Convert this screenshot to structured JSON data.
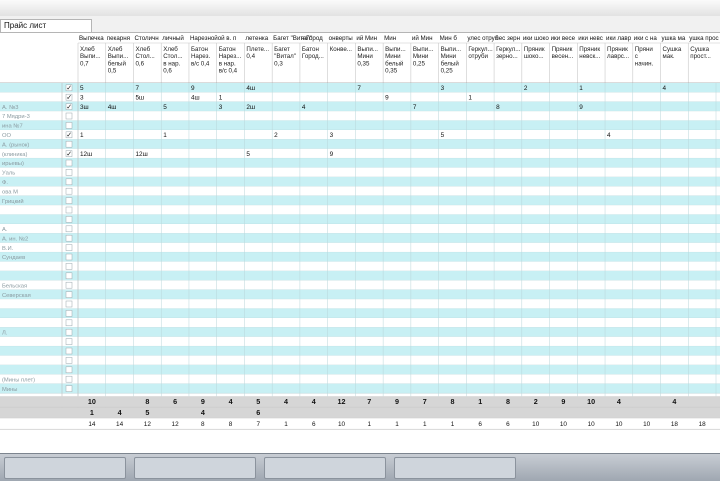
{
  "tab": {
    "label": "Прайс лист"
  },
  "colors": {
    "row_blue": "#c8f0f4",
    "row_white": "#ffffff",
    "grid": "#b9d6da",
    "total_gray": "#d6d6d6"
  },
  "columns": [
    {
      "group": "Выпечка",
      "name": "Хлеб\nВыпи...\n0,7"
    },
    {
      "group": "пекарня",
      "name": "Хлеб\nВыпи...\nбелый\n0,5"
    },
    {
      "group": "Столичн",
      "name": "Хлеб\nСтол...\n0,6"
    },
    {
      "group": "личный",
      "name": "Хлеб\nСтол...\nв нар.\n0,6"
    },
    {
      "group": "Нарезной",
      "name": "Батон\nНарез.\nв/с 0,4"
    },
    {
      "group": "ой в. п",
      "name": "Батон\nНарез...\nв нар.\nв/с 0,4"
    },
    {
      "group": "летенка",
      "name": "Плете...\n0,4"
    },
    {
      "group": "Багет \"Витал\"",
      "name": "Багет\n\"Витал\"\n0,3"
    },
    {
      "group": "н Город",
      "name": "Батон\nГород..."
    },
    {
      "group": "онверты",
      "name": "Конве..."
    },
    {
      "group": "ий Мин",
      "name": "Выпи...\nМини\n0,35"
    },
    {
      "group": "Мин",
      "name": "Выпи...\nМини\nбелый\n0,35"
    },
    {
      "group": "ий Мин",
      "name": "Выпи...\nМини\n0,25"
    },
    {
      "group": "Мин б",
      "name": "Выпи...\nМини\nбелый\n0,25"
    },
    {
      "group": "улес отруб",
      "name": "Геркул...\nотруби"
    },
    {
      "group": "лес зерн",
      "name": "Геркул...\nзерно..."
    },
    {
      "group": "ики шоко",
      "name": "Пряник\nшоко..."
    },
    {
      "group": "ики весе",
      "name": "Пряник\nвесен..."
    },
    {
      "group": "ики невс",
      "name": "Пряник\nневск..."
    },
    {
      "group": "ики лавр",
      "name": "Пряник\nлаврс..."
    },
    {
      "group": "ики с на",
      "name": "Пряни\nс\nначин."
    },
    {
      "group": "ушка ма",
      "name": "Сушка\nмак."
    },
    {
      "group": "ушка прос",
      "name": "Сушка\nпрост..."
    }
  ],
  "rows": [
    {
      "label": "",
      "check": "✓",
      "cells": [
        "5",
        "",
        "7",
        "",
        "9",
        "",
        "4ш",
        "",
        "",
        "",
        "7",
        "",
        "",
        "3",
        "",
        "",
        "2",
        "",
        "1",
        "",
        "",
        "4",
        ""
      ]
    },
    {
      "label": "",
      "check": "✓",
      "cells": [
        "3",
        "",
        "5ш",
        "",
        "4ш",
        "1",
        "",
        "",
        "",
        "",
        "",
        "9",
        "",
        "",
        "1",
        "",
        "",
        "",
        "",
        "",
        "",
        "",
        ""
      ]
    },
    {
      "label": "А. №3",
      "check": "✓",
      "cells": [
        "3ш",
        "4ш",
        "",
        "5",
        "",
        "3",
        "2ш",
        "",
        "4",
        "",
        "",
        "",
        "7",
        "",
        "",
        "8",
        "",
        "",
        "9",
        "",
        "",
        "",
        ""
      ]
    },
    {
      "label": "7 Мядри-3",
      "check": "",
      "cells": [
        "",
        "",
        "",
        "",
        "",
        "",
        "",
        "",
        "",
        "",
        "",
        "",
        "",
        "",
        "",
        "",
        "",
        "",
        "",
        "",
        "",
        "",
        ""
      ]
    },
    {
      "label": "ина №7",
      "check": "",
      "cells": [
        "",
        "",
        "",
        "",
        "",
        "",
        "",
        "",
        "",
        "",
        "",
        "",
        "",
        "",
        "",
        "",
        "",
        "",
        "",
        "",
        "",
        "",
        ""
      ]
    },
    {
      "label": "ОО",
      "check": "✓",
      "cells": [
        "1",
        "",
        "",
        "1",
        "",
        "",
        "",
        "2",
        "",
        "3",
        "",
        "",
        "",
        "5",
        "",
        "",
        "",
        "",
        "",
        "4",
        "",
        "",
        ""
      ]
    },
    {
      "label": "А. (рынок)",
      "check": "",
      "cells": [
        "",
        "",
        "",
        "",
        "",
        "",
        "",
        "",
        "",
        "",
        "",
        "",
        "",
        "",
        "",
        "",
        "",
        "",
        "",
        "",
        "",
        "",
        ""
      ]
    },
    {
      "label": "(клиника)",
      "check": "✓",
      "cells": [
        "12ш",
        "",
        "12ш",
        "",
        "",
        "",
        "5",
        "",
        "",
        "9",
        "",
        "",
        "",
        "",
        "",
        "",
        "",
        "",
        "",
        "",
        "",
        "",
        ""
      ]
    },
    {
      "label": "ирьевы)",
      "check": "",
      "cells": [
        "",
        "",
        "",
        "",
        "",
        "",
        "",
        "",
        "",
        "",
        "",
        "",
        "",
        "",
        "",
        "",
        "",
        "",
        "",
        "",
        "",
        "",
        ""
      ]
    },
    {
      "label": "Уаль",
      "check": "",
      "cells": [
        "",
        "",
        "",
        "",
        "",
        "",
        "",
        "",
        "",
        "",
        "",
        "",
        "",
        "",
        "",
        "",
        "",
        "",
        "",
        "",
        "",
        "",
        ""
      ]
    },
    {
      "label": "Ф.",
      "check": "",
      "cells": [
        "",
        "",
        "",
        "",
        "",
        "",
        "",
        "",
        "",
        "",
        "",
        "",
        "",
        "",
        "",
        "",
        "",
        "",
        "",
        "",
        "",
        "",
        ""
      ]
    },
    {
      "label": "ова М",
      "check": "",
      "cells": [
        "",
        "",
        "",
        "",
        "",
        "",
        "",
        "",
        "",
        "",
        "",
        "",
        "",
        "",
        "",
        "",
        "",
        "",
        "",
        "",
        "",
        "",
        ""
      ]
    },
    {
      "label": "Грицкий",
      "check": "",
      "cells": [
        "",
        "",
        "",
        "",
        "",
        "",
        "",
        "",
        "",
        "",
        "",
        "",
        "",
        "",
        "",
        "",
        "",
        "",
        "",
        "",
        "",
        "",
        ""
      ]
    },
    {
      "label": "",
      "check": "",
      "cells": [
        "",
        "",
        "",
        "",
        "",
        "",
        "",
        "",
        "",
        "",
        "",
        "",
        "",
        "",
        "",
        "",
        "",
        "",
        "",
        "",
        "",
        "",
        ""
      ]
    },
    {
      "label": "",
      "check": "",
      "cells": [
        "",
        "",
        "",
        "",
        "",
        "",
        "",
        "",
        "",
        "",
        "",
        "",
        "",
        "",
        "",
        "",
        "",
        "",
        "",
        "",
        "",
        "",
        ""
      ]
    },
    {
      "label": "А.",
      "check": "",
      "cells": [
        "",
        "",
        "",
        "",
        "",
        "",
        "",
        "",
        "",
        "",
        "",
        "",
        "",
        "",
        "",
        "",
        "",
        "",
        "",
        "",
        "",
        "",
        ""
      ]
    },
    {
      "label": "А. ин. №2",
      "check": "",
      "cells": [
        "",
        "",
        "",
        "",
        "",
        "",
        "",
        "",
        "",
        "",
        "",
        "",
        "",
        "",
        "",
        "",
        "",
        "",
        "",
        "",
        "",
        "",
        ""
      ]
    },
    {
      "label": "В.И.",
      "check": "",
      "cells": [
        "",
        "",
        "",
        "",
        "",
        "",
        "",
        "",
        "",
        "",
        "",
        "",
        "",
        "",
        "",
        "",
        "",
        "",
        "",
        "",
        "",
        "",
        ""
      ]
    },
    {
      "label": "Сундаев",
      "check": "",
      "cells": [
        "",
        "",
        "",
        "",
        "",
        "",
        "",
        "",
        "",
        "",
        "",
        "",
        "",
        "",
        "",
        "",
        "",
        "",
        "",
        "",
        "",
        "",
        ""
      ]
    },
    {
      "label": "",
      "check": "",
      "cells": [
        "",
        "",
        "",
        "",
        "",
        "",
        "",
        "",
        "",
        "",
        "",
        "",
        "",
        "",
        "",
        "",
        "",
        "",
        "",
        "",
        "",
        "",
        ""
      ]
    },
    {
      "label": "",
      "check": "",
      "cells": [
        "",
        "",
        "",
        "",
        "",
        "",
        "",
        "",
        "",
        "",
        "",
        "",
        "",
        "",
        "",
        "",
        "",
        "",
        "",
        "",
        "",
        "",
        ""
      ]
    },
    {
      "label": "Бельская",
      "check": "",
      "cells": [
        "",
        "",
        "",
        "",
        "",
        "",
        "",
        "",
        "",
        "",
        "",
        "",
        "",
        "",
        "",
        "",
        "",
        "",
        "",
        "",
        "",
        "",
        ""
      ]
    },
    {
      "label": "Северская",
      "check": "",
      "cells": [
        "",
        "",
        "",
        "",
        "",
        "",
        "",
        "",
        "",
        "",
        "",
        "",
        "",
        "",
        "",
        "",
        "",
        "",
        "",
        "",
        "",
        "",
        ""
      ]
    },
    {
      "label": "",
      "check": "",
      "cells": [
        "",
        "",
        "",
        "",
        "",
        "",
        "",
        "",
        "",
        "",
        "",
        "",
        "",
        "",
        "",
        "",
        "",
        "",
        "",
        "",
        "",
        "",
        ""
      ]
    },
    {
      "label": "",
      "check": "",
      "cells": [
        "",
        "",
        "",
        "",
        "",
        "",
        "",
        "",
        "",
        "",
        "",
        "",
        "",
        "",
        "",
        "",
        "",
        "",
        "",
        "",
        "",
        "",
        ""
      ]
    },
    {
      "label": "",
      "check": "",
      "cells": [
        "",
        "",
        "",
        "",
        "",
        "",
        "",
        "",
        "",
        "",
        "",
        "",
        "",
        "",
        "",
        "",
        "",
        "",
        "",
        "",
        "",
        "",
        ""
      ]
    },
    {
      "label": "Л.",
      "check": "",
      "cells": [
        "",
        "",
        "",
        "",
        "",
        "",
        "",
        "",
        "",
        "",
        "",
        "",
        "",
        "",
        "",
        "",
        "",
        "",
        "",
        "",
        "",
        "",
        ""
      ]
    },
    {
      "label": "",
      "check": "",
      "cells": [
        "",
        "",
        "",
        "",
        "",
        "",
        "",
        "",
        "",
        "",
        "",
        "",
        "",
        "",
        "",
        "",
        "",
        "",
        "",
        "",
        "",
        "",
        ""
      ]
    },
    {
      "label": "",
      "check": "",
      "cells": [
        "",
        "",
        "",
        "",
        "",
        "",
        "",
        "",
        "",
        "",
        "",
        "",
        "",
        "",
        "",
        "",
        "",
        "",
        "",
        "",
        "",
        "",
        ""
      ]
    },
    {
      "label": "",
      "check": "",
      "cells": [
        "",
        "",
        "",
        "",
        "",
        "",
        "",
        "",
        "",
        "",
        "",
        "",
        "",
        "",
        "",
        "",
        "",
        "",
        "",
        "",
        "",
        "",
        ""
      ]
    },
    {
      "label": "",
      "check": "",
      "cells": [
        "",
        "",
        "",
        "",
        "",
        "",
        "",
        "",
        "",
        "",
        "",
        "",
        "",
        "",
        "",
        "",
        "",
        "",
        "",
        "",
        "",
        "",
        ""
      ]
    },
    {
      "label": "(Мины плет)",
      "check": "",
      "cells": [
        "",
        "",
        "",
        "",
        "",
        "",
        "",
        "",
        "",
        "",
        "",
        "",
        "",
        "",
        "",
        "",
        "",
        "",
        "",
        "",
        "",
        "",
        ""
      ]
    },
    {
      "label": "Мины",
      "check": "",
      "cells": [
        "",
        "",
        "",
        "",
        "",
        "",
        "",
        "",
        "",
        "",
        "",
        "",
        "",
        "",
        "",
        "",
        "",
        "",
        "",
        "",
        "",
        "",
        ""
      ]
    }
  ],
  "totals": [
    {
      "cells": [
        "10",
        "",
        "8",
        "6",
        "9",
        "4",
        "5",
        "4",
        "4",
        "12",
        "7",
        "9",
        "7",
        "8",
        "1",
        "8",
        "2",
        "9",
        "10",
        "4",
        "",
        "4",
        ""
      ]
    },
    {
      "cells": [
        "1",
        "4",
        "5",
        "",
        "4",
        "",
        "6",
        "",
        "",
        "",
        "",
        "",
        "",
        "",
        "",
        "",
        "",
        "",
        "",
        "",
        "",
        "",
        ""
      ]
    },
    {
      "cells": [
        "14",
        "14",
        "12",
        "12",
        "8",
        "8",
        "7",
        "1",
        "6",
        "10",
        "1",
        "1",
        "1",
        "1",
        "6",
        "6",
        "10",
        "10",
        "10",
        "10",
        "10",
        "18",
        "18"
      ]
    }
  ]
}
